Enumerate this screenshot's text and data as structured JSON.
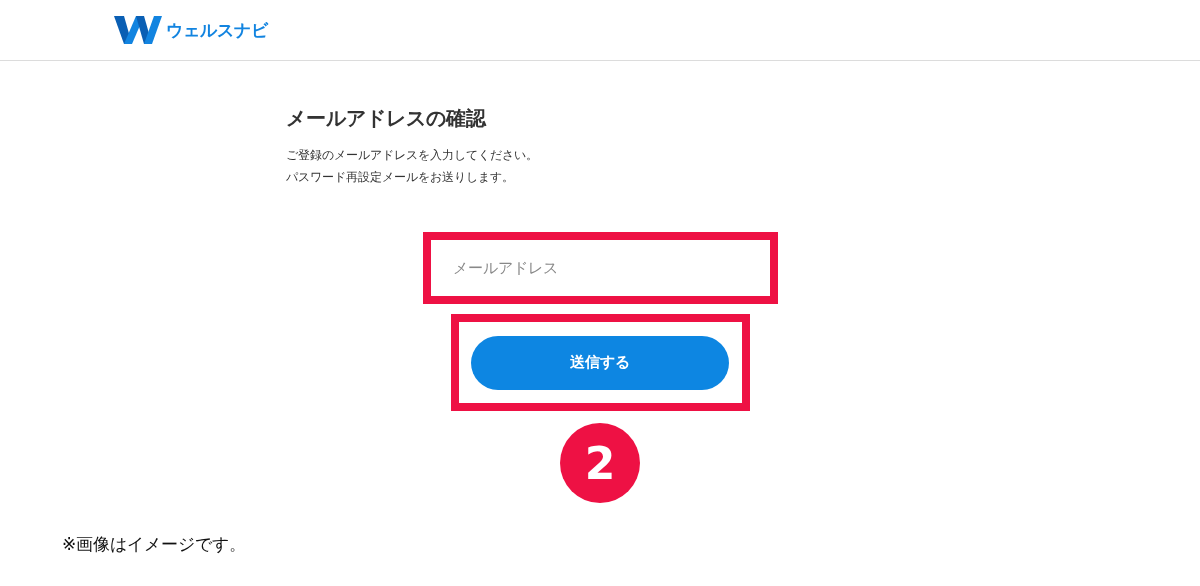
{
  "header": {
    "logo_text": "ウェルスナビ"
  },
  "form": {
    "title": "メールアドレスの確認",
    "instructions": [
      "ご登録のメールアドレスを入力してください。",
      "パスワード再設定メールをお送りします。"
    ],
    "email_field": {
      "placeholder": "メールアドレス"
    },
    "submit_button": "送信する"
  },
  "step_badge": "2",
  "note": "※画像はイメージです。"
}
